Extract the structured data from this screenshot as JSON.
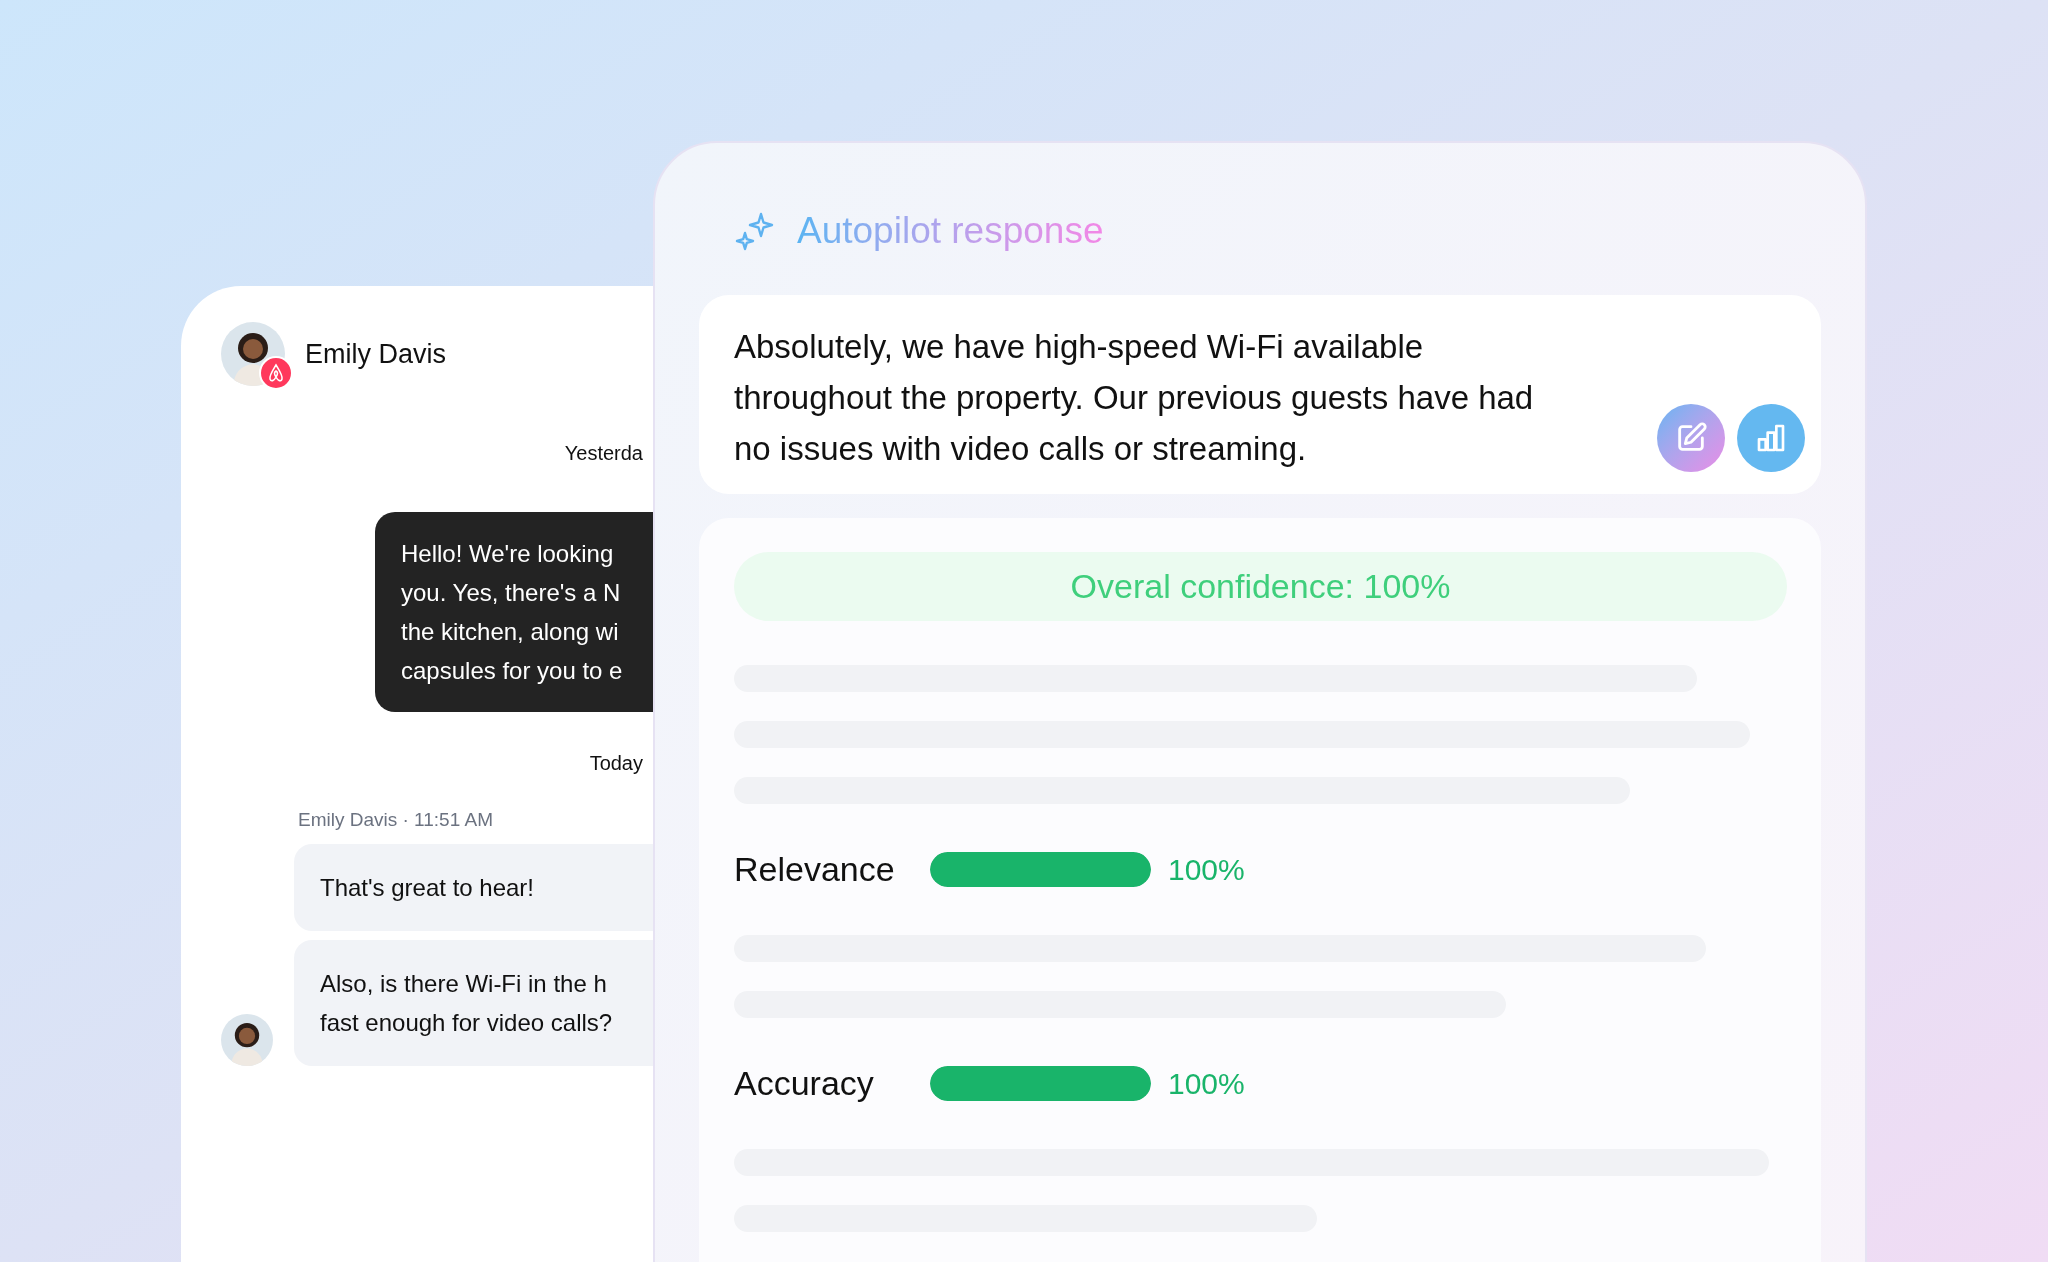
{
  "conversation": {
    "contact_name": "Emily Davis",
    "messages": [
      {
        "kind": "date",
        "text": "Yesterda"
      },
      {
        "kind": "outgoing",
        "lines": [
          "Hello! We're looking",
          "you. Yes, there's a N",
          "the kitchen, along wi",
          "capsules for you to e"
        ]
      },
      {
        "kind": "date",
        "text": "Today"
      },
      {
        "kind": "meta",
        "text": "Emily Davis · 11:51 AM"
      },
      {
        "kind": "incoming",
        "lines": [
          "That's great to hear!"
        ]
      },
      {
        "kind": "incoming",
        "lines": [
          "Also, is there Wi-Fi in the h",
          "fast enough for video calls?"
        ],
        "avatar": true
      }
    ]
  },
  "autopilot": {
    "title_parts": [
      "Autopilot",
      "response"
    ],
    "response": "Absolutely, we have high-speed Wi-Fi available throughout the property. Our previous guests have had no issues with video calls or streaming.",
    "confidence": "Overal confidence: 100%",
    "metrics": [
      {
        "label": "Relevance",
        "level": 1,
        "reading": "100%"
      },
      {
        "label": "Accuracy",
        "level": 1,
        "reading": "100%"
      }
    ]
  }
}
